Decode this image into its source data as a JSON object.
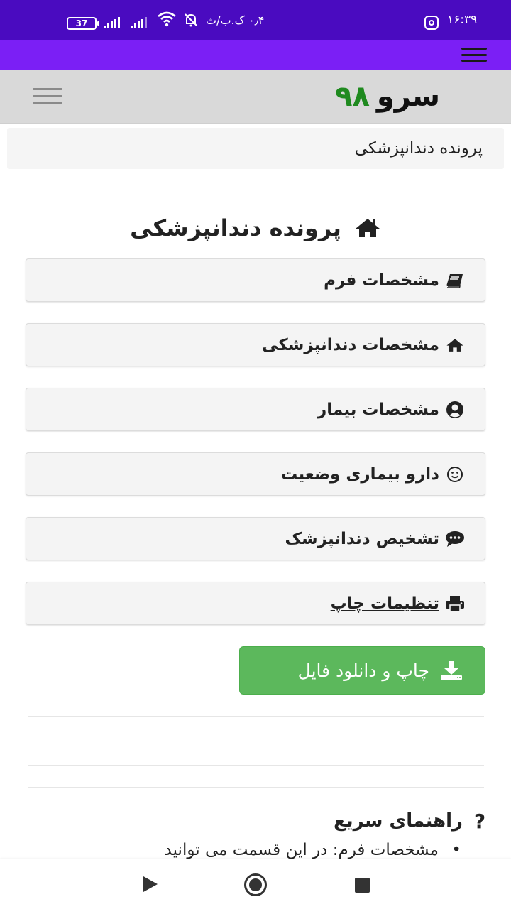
{
  "status_bar": {
    "time": "۱۶:۳۹",
    "net_speed": "۰٫۴ ک.ب/ث",
    "battery": "37"
  },
  "header": {
    "logo_word": "سرو",
    "logo_number": "۹۸"
  },
  "breadcrumb": {
    "text": "پرونده دندانپزشکی"
  },
  "page": {
    "title": "پرونده دندانپزشکی"
  },
  "menu": {
    "items": [
      {
        "label": "مشخصات فرم",
        "icon": "book-icon"
      },
      {
        "label": "مشخصات دندانپزشکی",
        "icon": "home-icon"
      },
      {
        "label": "مشخصات بیمار",
        "icon": "user-circle-icon"
      },
      {
        "label": "دارو بیماری وضعیت",
        "icon": "smile-icon"
      },
      {
        "label": "تشخیص دندانپزشک",
        "icon": "comments-icon"
      },
      {
        "label": "تنظیمات چاپ",
        "icon": "print-icon"
      }
    ]
  },
  "download": {
    "label": "چاپ و دانلود فایل"
  },
  "guide": {
    "title": "راهنمای سریع",
    "question_mark": "?",
    "item_1": "مشخصات فرم: در این قسمت می توانید"
  },
  "colors": {
    "status_bar": "#4a0bc0",
    "app_bar": "#7b1ff5",
    "logo_number": "#1f8a1f",
    "download_button": "#5cb85c"
  }
}
